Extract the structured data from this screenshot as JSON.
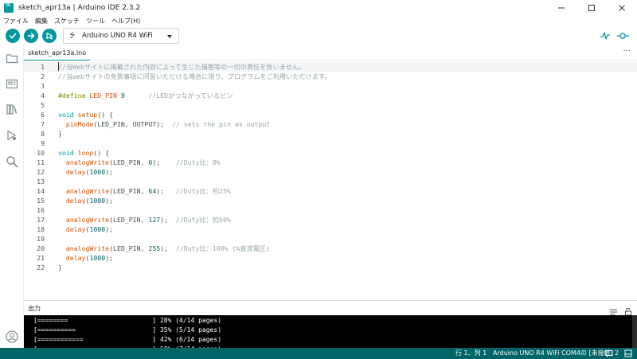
{
  "window": {
    "title": "sketch_apr13a | Arduino IDE 2.3.2",
    "controls": [
      "minimize-icon",
      "maximize-icon",
      "close-icon"
    ]
  },
  "menu": [
    "ファイル",
    "編集",
    "スケッチ",
    "ツール",
    "ヘルプ(H)"
  ],
  "toolbar": {
    "verify_icon": "checkmark-icon",
    "upload_icon": "arrow-right-icon",
    "debug_icon": "debugger-icon",
    "board": "Arduino UNO R4 WiFi",
    "serial_plotter_icon": "serial-plotter-icon",
    "serial_monitor_icon": "serial-monitor-icon"
  },
  "sidebar": [
    "folder-icon",
    "board-manager-icon",
    "library-icon",
    "debug-icon",
    "search-icon",
    "account-icon"
  ],
  "tab": {
    "name": "sketch_apr13a.ino",
    "more": "···"
  },
  "editor": {
    "lines": [
      {
        "n": "1",
        "t": [
          [
            "c-cm",
            "//当Webサイトに掲載された内容によって生じた損害等の一切の責任を負いません。"
          ]
        ]
      },
      {
        "n": "2",
        "t": [
          [
            "c-cm",
            "//当webサイトの免責事項に同意いただける場合に限り、プログラムをご利用いただけます。"
          ]
        ]
      },
      {
        "n": "3",
        "t": []
      },
      {
        "n": "4",
        "t": [
          [
            "c-pp",
            "#define"
          ],
          [
            "c-tx",
            " "
          ],
          [
            "c-fn",
            "LED_PIN"
          ],
          [
            "c-tx",
            " "
          ],
          [
            "c-num",
            "9"
          ],
          [
            "c-tx",
            "      "
          ],
          [
            "c-cm",
            "//LEDがつながっているピン"
          ]
        ]
      },
      {
        "n": "5",
        "t": []
      },
      {
        "n": "6",
        "t": [
          [
            "c-kw",
            "void"
          ],
          [
            "c-tx",
            " "
          ],
          [
            "c-fn",
            "setup"
          ],
          [
            "c-tx",
            "() {"
          ]
        ]
      },
      {
        "n": "7",
        "t": [
          [
            "c-tx",
            "  "
          ],
          [
            "c-fn",
            "pinMode"
          ],
          [
            "c-tx",
            "(LED_PIN, OUTPUT);  "
          ],
          [
            "c-cm",
            "// sets the pin as output"
          ]
        ]
      },
      {
        "n": "8",
        "t": [
          [
            "c-tx",
            "}"
          ]
        ]
      },
      {
        "n": "9",
        "t": []
      },
      {
        "n": "10",
        "t": [
          [
            "c-kw",
            "void"
          ],
          [
            "c-tx",
            " "
          ],
          [
            "c-fn",
            "loop"
          ],
          [
            "c-tx",
            "() {"
          ]
        ]
      },
      {
        "n": "11",
        "t": [
          [
            "c-tx",
            "  "
          ],
          [
            "c-fn",
            "analogWrite"
          ],
          [
            "c-tx",
            "(LED_PIN, "
          ],
          [
            "c-num",
            "0"
          ],
          [
            "c-tx",
            ");    "
          ],
          [
            "c-cm",
            "//Duty比：0%"
          ]
        ]
      },
      {
        "n": "12",
        "t": [
          [
            "c-tx",
            "  "
          ],
          [
            "c-fn",
            "delay"
          ],
          [
            "c-tx",
            "("
          ],
          [
            "c-num",
            "1000"
          ],
          [
            "c-tx",
            ");"
          ]
        ]
      },
      {
        "n": "13",
        "t": []
      },
      {
        "n": "14",
        "t": [
          [
            "c-tx",
            "  "
          ],
          [
            "c-fn",
            "analogWrite"
          ],
          [
            "c-tx",
            "(LED_PIN, "
          ],
          [
            "c-num",
            "64"
          ],
          [
            "c-tx",
            ");   "
          ],
          [
            "c-cm",
            "//Duty比：約25%"
          ]
        ]
      },
      {
        "n": "15",
        "t": [
          [
            "c-tx",
            "  "
          ],
          [
            "c-fn",
            "delay"
          ],
          [
            "c-tx",
            "("
          ],
          [
            "c-num",
            "1000"
          ],
          [
            "c-tx",
            ");"
          ]
        ]
      },
      {
        "n": "16",
        "t": []
      },
      {
        "n": "17",
        "t": [
          [
            "c-tx",
            "  "
          ],
          [
            "c-fn",
            "analogWrite"
          ],
          [
            "c-tx",
            "(LED_PIN, "
          ],
          [
            "c-num",
            "127"
          ],
          [
            "c-tx",
            ");  "
          ],
          [
            "c-cm",
            "//Duty比：約50%"
          ]
        ]
      },
      {
        "n": "18",
        "t": [
          [
            "c-tx",
            "  "
          ],
          [
            "c-fn",
            "delay"
          ],
          [
            "c-tx",
            "("
          ],
          [
            "c-num",
            "1000"
          ],
          [
            "c-tx",
            ");"
          ]
        ]
      },
      {
        "n": "19",
        "t": []
      },
      {
        "n": "20",
        "t": [
          [
            "c-tx",
            "  "
          ],
          [
            "c-fn",
            "analogWrite"
          ],
          [
            "c-tx",
            "(LED_PIN, "
          ],
          [
            "c-num",
            "255"
          ],
          [
            "c-tx",
            ");  "
          ],
          [
            "c-cm",
            "//Duty比：100% (≒直流電圧)"
          ]
        ]
      },
      {
        "n": "21",
        "t": [
          [
            "c-tx",
            "  "
          ],
          [
            "c-fn",
            "delay"
          ],
          [
            "c-tx",
            "("
          ],
          [
            "c-num",
            "1000"
          ],
          [
            "c-tx",
            ");"
          ]
        ]
      },
      {
        "n": "22",
        "t": [
          [
            "c-tx",
            "}"
          ]
        ]
      }
    ]
  },
  "output": {
    "title": "出力",
    "clear_icon": "clear-output-icon",
    "lock_icon": "scroll-lock-icon",
    "lines": [
      "[========                      ] 28% (4/14 pages)",
      "[==========                    ] 35% (5/14 pages)",
      "[============                  ] 42% (6/14 pages)",
      "[==============                ] 50% (7/14 pages)"
    ]
  },
  "status": {
    "position": "行 1、列 1",
    "board": "Arduino UNO R4 WiFi COM4の [未接続]",
    "notifications_icon": "notification-icon",
    "notifications": "2",
    "layout_icon": "panel-icon"
  },
  "colors": {
    "accent": "#00979d",
    "statusbar": "#006468",
    "output_bg": "#000000"
  }
}
